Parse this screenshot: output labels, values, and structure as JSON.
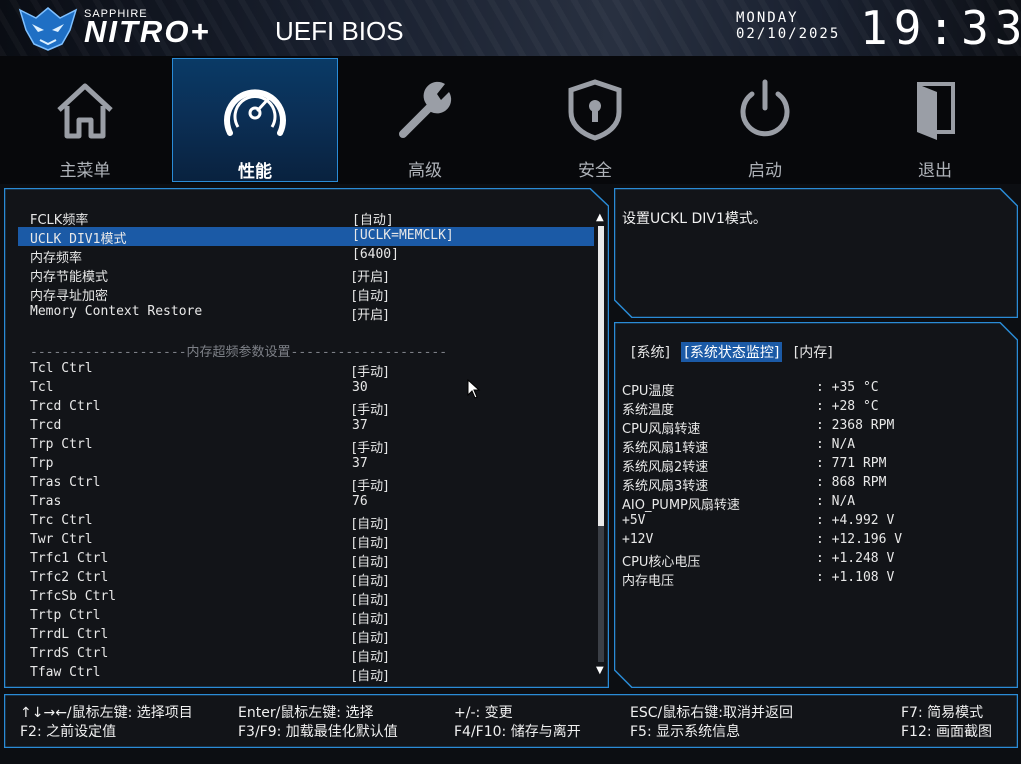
{
  "header": {
    "brand_small": "SAPPHIRE",
    "brand_big": "NITRO+",
    "title": "UEFI BIOS",
    "day": "MONDAY",
    "date": "02/10/2025",
    "time": "19:33"
  },
  "nav": {
    "tabs": [
      {
        "label": "主菜单",
        "icon": "home-icon"
      },
      {
        "label": "性能",
        "icon": "speedometer-icon",
        "active": true
      },
      {
        "label": "高级",
        "icon": "wrench-icon"
      },
      {
        "label": "安全",
        "icon": "shield-lock-icon"
      },
      {
        "label": "启动",
        "icon": "power-icon"
      },
      {
        "label": "退出",
        "icon": "exit-door-icon"
      }
    ]
  },
  "settings": {
    "top": [
      {
        "name": "FCLK频率",
        "value": "[自动]"
      },
      {
        "name": "UCLK DIV1模式",
        "value": "[UCLK=MEMCLK]",
        "selected": true
      },
      {
        "name": "内存频率",
        "value": "[6400]"
      },
      {
        "name": "内存节能模式",
        "value": "[开启]"
      },
      {
        "name": "内存寻址加密",
        "value": "[自动]"
      },
      {
        "name": "Memory Context Restore",
        "value": "[开启]"
      }
    ],
    "divider": "--------------------内存超频参数设置--------------------",
    "timings": [
      {
        "name": "Tcl Ctrl",
        "value": "[手动]"
      },
      {
        "name": "Tcl",
        "value": "30"
      },
      {
        "name": "Trcd Ctrl",
        "value": "[手动]"
      },
      {
        "name": "Trcd",
        "value": "37"
      },
      {
        "name": "Trp Ctrl",
        "value": "[手动]"
      },
      {
        "name": "Trp",
        "value": "37"
      },
      {
        "name": "Tras Ctrl",
        "value": "[手动]"
      },
      {
        "name": "Tras",
        "value": "76"
      },
      {
        "name": "Trc Ctrl",
        "value": "[自动]"
      },
      {
        "name": "Twr Ctrl",
        "value": "[自动]"
      },
      {
        "name": "Trfc1 Ctrl",
        "value": "[自动]"
      },
      {
        "name": "Trfc2 Ctrl",
        "value": "[自动]"
      },
      {
        "name": "TrfcSb Ctrl",
        "value": "[自动]"
      },
      {
        "name": "Trtp Ctrl",
        "value": "[自动]"
      },
      {
        "name": "TrrdL Ctrl",
        "value": "[自动]"
      },
      {
        "name": "TrrdS Ctrl",
        "value": "[自动]"
      },
      {
        "name": "Tfaw Ctrl",
        "value": "[自动]"
      }
    ]
  },
  "help": {
    "text": "设置UCKL DIV1模式。"
  },
  "monitor": {
    "tabs": [
      {
        "label": "[系统]"
      },
      {
        "label": "[系统状态监控]",
        "active": true
      },
      {
        "label": "[内存]"
      }
    ],
    "rows": [
      {
        "label": "CPU温度",
        "value": ": +35 °C"
      },
      {
        "label": "系统温度",
        "value": ": +28 °C"
      },
      {
        "label": "CPU风扇转速",
        "value": ": 2368 RPM"
      },
      {
        "label": "系统风扇1转速",
        "value": ": N/A"
      },
      {
        "label": "系统风扇2转速",
        "value": ": 771 RPM"
      },
      {
        "label": "系统风扇3转速",
        "value": ": 868 RPM"
      },
      {
        "label": "AIO_PUMP风扇转速",
        "value": ": N/A"
      },
      {
        "label": "+5V",
        "value": ": +4.992 V"
      },
      {
        "label": "+12V",
        "value": ": +12.196 V"
      },
      {
        "label": "CPU核心电压",
        "value": ": +1.248 V"
      },
      {
        "label": "内存电压",
        "value": ": +1.108 V"
      }
    ]
  },
  "footer": {
    "row1": [
      "↑↓→←/鼠标左键: 选择项目",
      "Enter/鼠标左键: 选择",
      "+/-: 变更",
      "ESC/鼠标右键:取消并返回",
      "F7: 简易模式"
    ],
    "row2": [
      "F2: 之前设定值",
      "F3/F9: 加载最佳化默认值",
      "F4/F10: 储存与离开",
      "F5: 显示系统信息",
      "F12: 画面截图"
    ]
  },
  "colors": {
    "accent": "#1b5aa6",
    "frame": "#2a8bd6",
    "background": "#0c0e12"
  }
}
